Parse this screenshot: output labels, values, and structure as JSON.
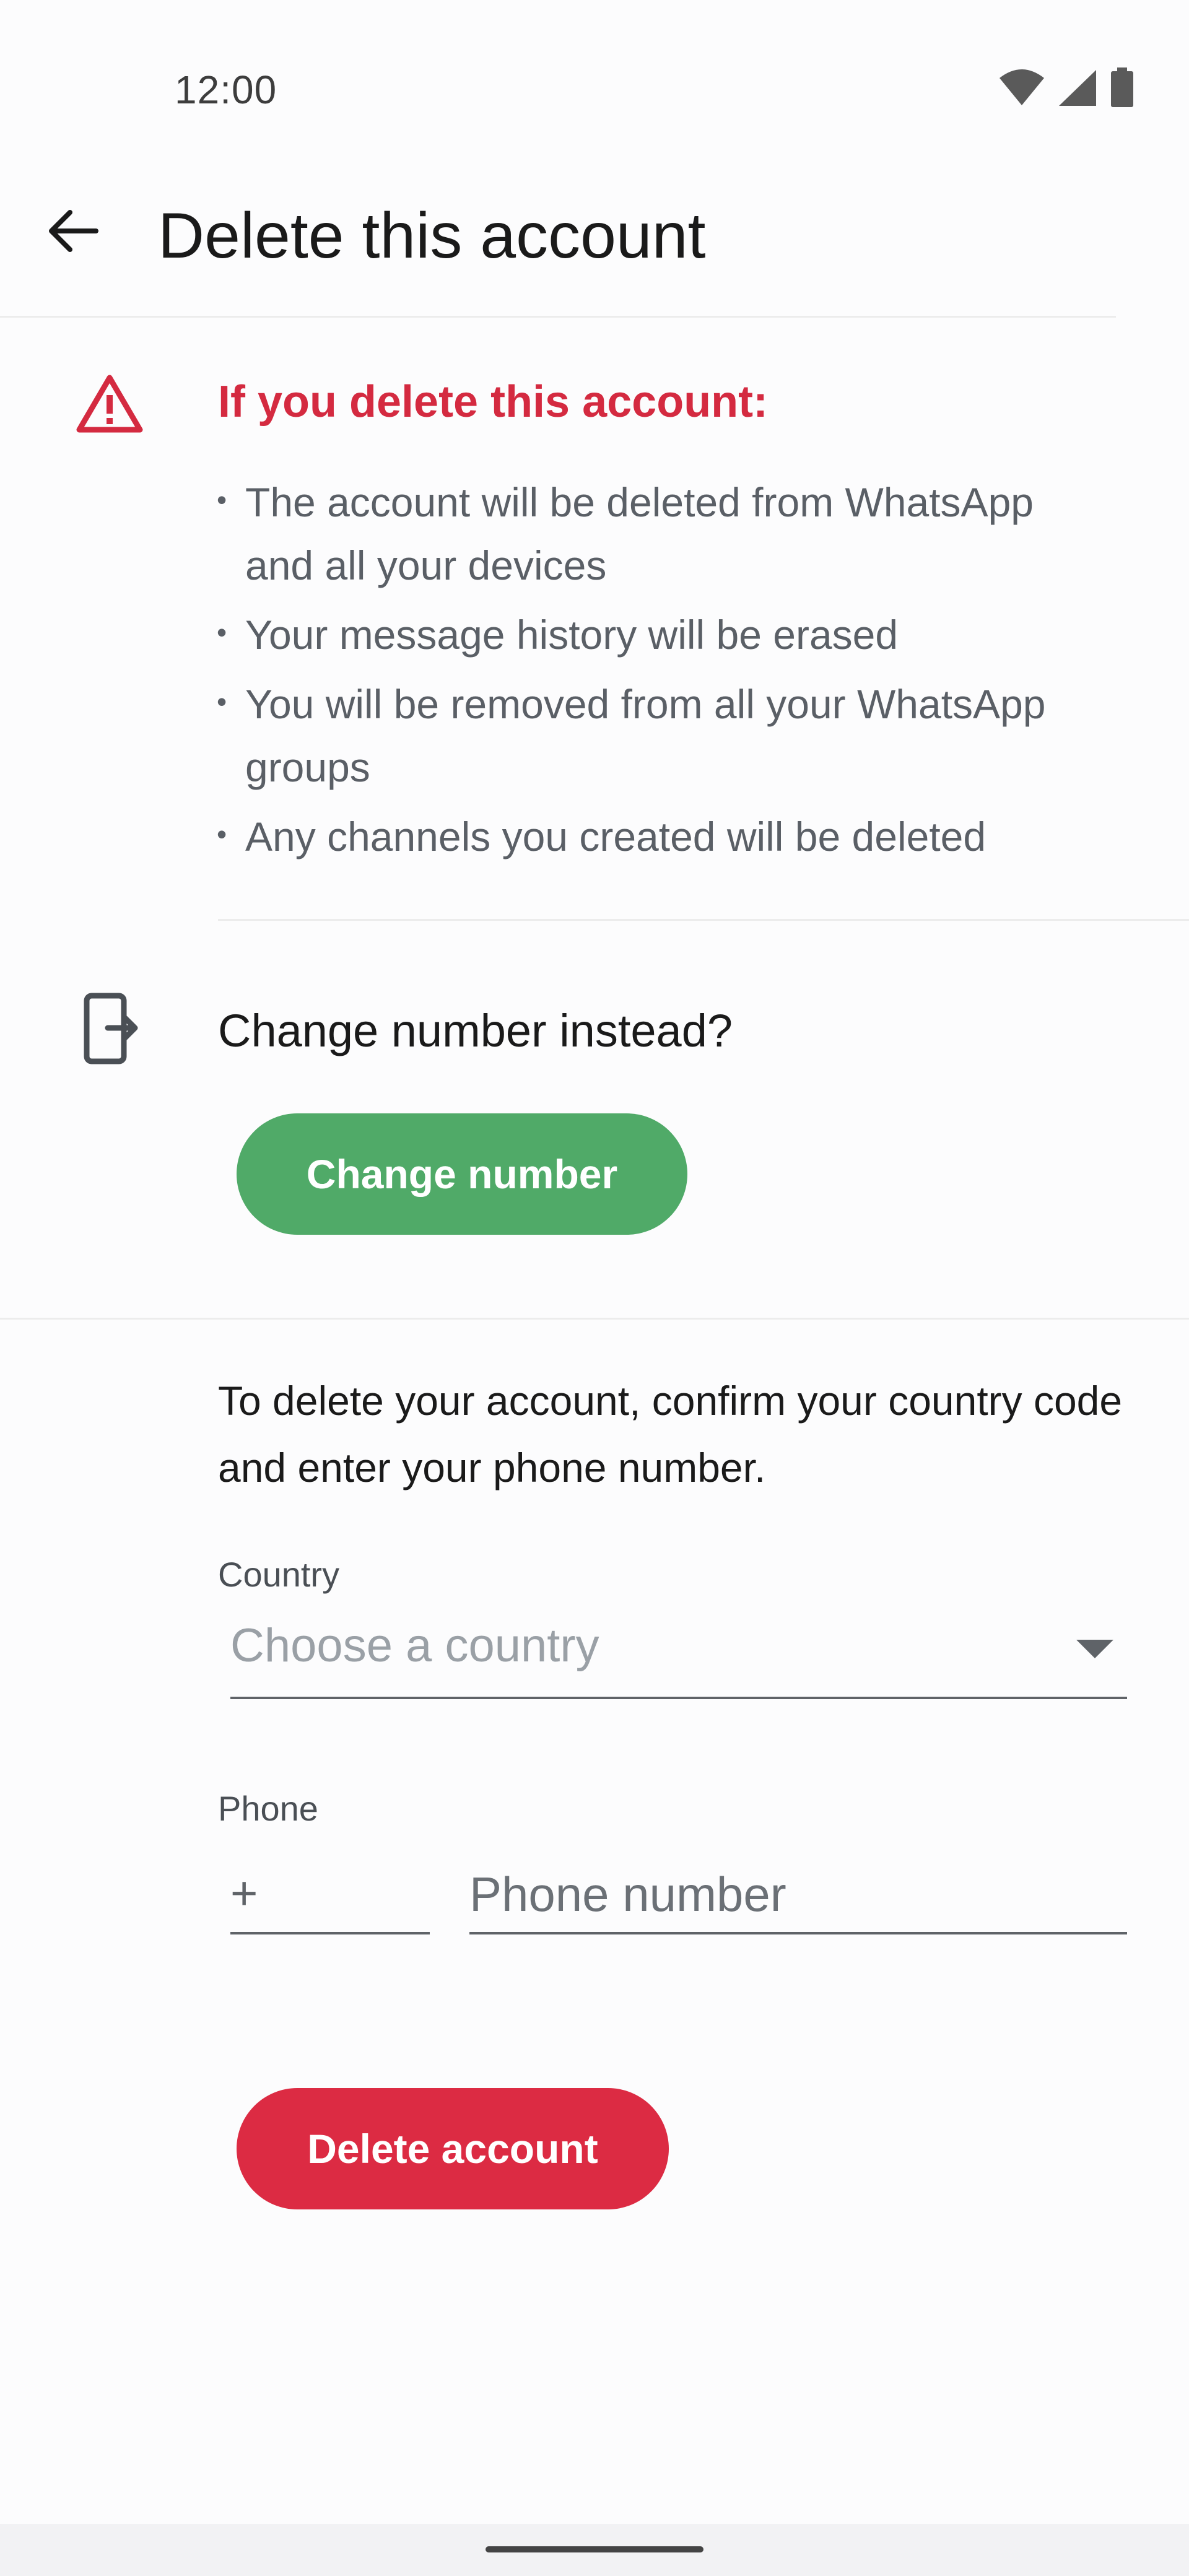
{
  "status_bar": {
    "time": "12:00",
    "icons": [
      "wifi-icon",
      "cellular-signal-icon",
      "battery-icon"
    ]
  },
  "app_bar": {
    "title": "Delete this account",
    "back_icon": "arrow-back-icon"
  },
  "warning": {
    "icon": "warning-triangle-icon",
    "heading": "If you delete this account:",
    "items": [
      "The account will be deleted from WhatsApp and all your devices",
      "Your message history will be erased",
      "You will be removed from all your WhatsApp groups",
      "Any channels you created will be deleted"
    ]
  },
  "change_number": {
    "icon": "phone-swap-icon",
    "prompt": "Change number instead?",
    "button_label": "Change number"
  },
  "confirm_form": {
    "instructions": "To delete your account, confirm your country code and enter your phone number.",
    "country_label": "Country",
    "country_placeholder": "Choose a country",
    "phone_label": "Phone",
    "country_code_prefix": "+",
    "phone_placeholder": "Phone number",
    "delete_button_label": "Delete account"
  },
  "colors": {
    "danger": "#dc2b43",
    "warning_heading": "#d42a40",
    "accent_green": "#50aa68",
    "background": "#fcfcfd"
  }
}
